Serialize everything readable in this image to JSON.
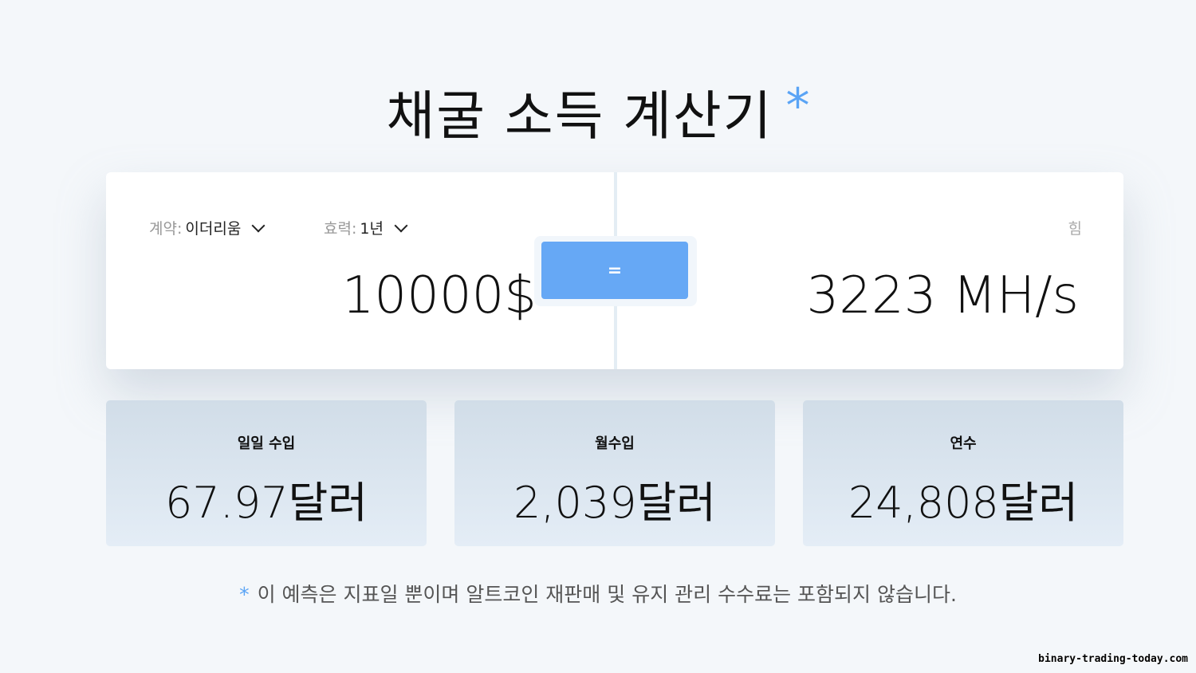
{
  "header": {
    "title": "채굴 소득 계산기",
    "title_marker": "*"
  },
  "calculator": {
    "contract_label": "계약:",
    "contract_value": "이더리움",
    "validity_label": "효력:",
    "validity_value": "1년",
    "power_label": "힘",
    "amount": "10000$",
    "equals_label": "=",
    "hashrate": "3223 MH/s"
  },
  "results": [
    {
      "label": "일일 수입",
      "value": "67.97달러"
    },
    {
      "label": "월수입",
      "value": "2,039달러"
    },
    {
      "label": "연수",
      "value": "24,808달러"
    }
  ],
  "footer": {
    "marker": "*",
    "disclaimer": "이 예측은 지표일 뿐이며 알트코인 재판매 및 유지 관리 수수료는 포함되지 않습니다.",
    "watermark": "binary-trading-today.com"
  },
  "colors": {
    "accent": "#5aa4f5",
    "button": "#66a8f5",
    "background": "#f4f7fa",
    "card": "#ffffff",
    "result_card": "#dde7f1"
  },
  "icons": {
    "dropdown": "chevron-down-icon"
  }
}
